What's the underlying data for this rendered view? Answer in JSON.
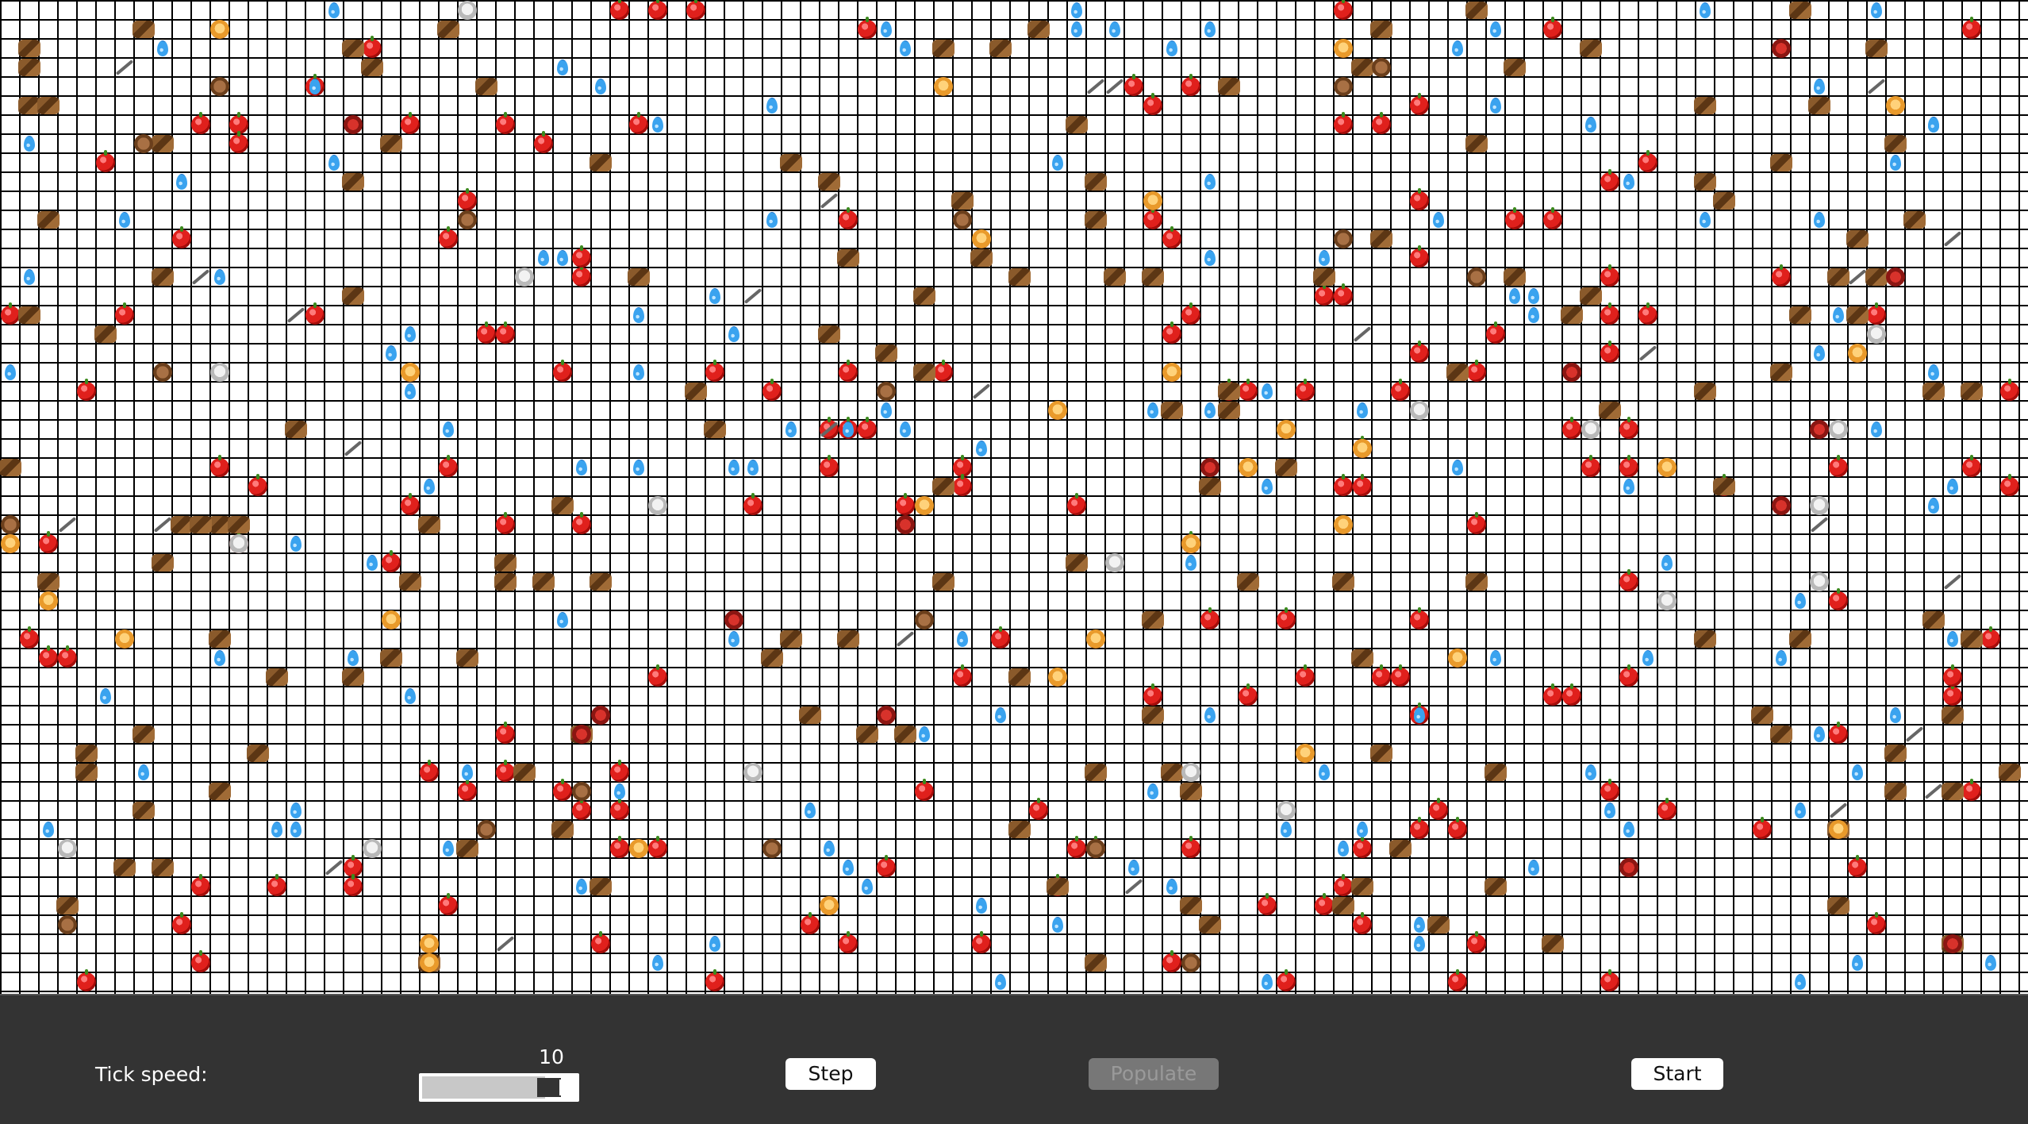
{
  "toolbar": {
    "tick_speed_label": "Tick speed:",
    "tick_speed_value": "10",
    "tick_speed_fraction": 0.8,
    "step_label": "Step",
    "populate_label": "Populate",
    "populate_enabled": false,
    "start_label": "Start"
  },
  "legend": {
    "apple": "apple-icon",
    "water": "water-drop-icon",
    "wood": "wood-log-icon",
    "animal": "animal-face-icon",
    "wolf": "wolf-icon",
    "bear": "bear-icon",
    "demon": "ogre-icon",
    "tool": "pickaxe-icon"
  }
}
